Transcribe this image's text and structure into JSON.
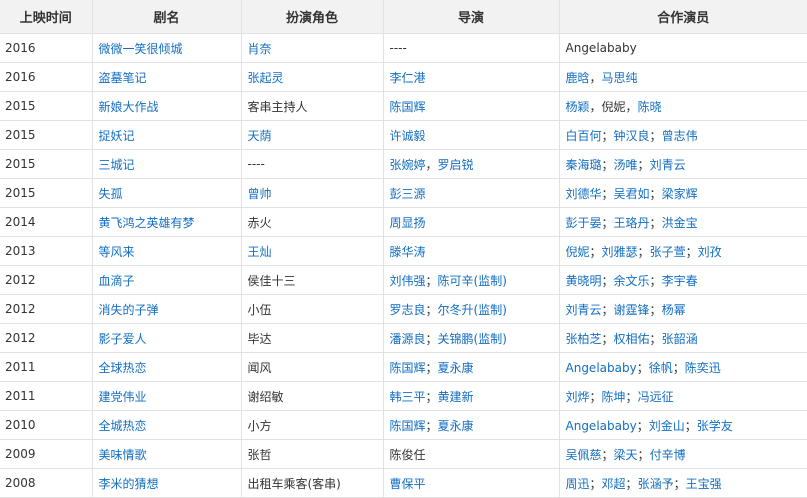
{
  "headers": [
    "上映时间",
    "剧名",
    "扮演角色",
    "导演",
    "合作演员"
  ],
  "rows": [
    {
      "year": "2016",
      "title": {
        "text": "微微一笑很倾城",
        "link": true
      },
      "role": {
        "text": "肖奈",
        "link": true
      },
      "director": [
        {
          "text": "----",
          "link": false
        }
      ],
      "director_sep": "",
      "costars": [
        {
          "text": "Angelababy",
          "link": false
        }
      ],
      "costar_sep": ""
    },
    {
      "year": "2016",
      "title": {
        "text": "盗墓笔记",
        "link": true
      },
      "role": {
        "text": "张起灵",
        "link": true
      },
      "director": [
        {
          "text": "李仁港",
          "link": true
        }
      ],
      "director_sep": "",
      "costars": [
        {
          "text": "鹿晗",
          "link": true
        },
        {
          "text": "马思纯",
          "link": true
        }
      ],
      "costar_sep": "，"
    },
    {
      "year": "2015",
      "title": {
        "text": "新娘大作战",
        "link": true
      },
      "role": {
        "text": "客串主持人",
        "link": false
      },
      "director": [
        {
          "text": "陈国辉",
          "link": true
        }
      ],
      "director_sep": "",
      "costars": [
        {
          "text": "杨颖",
          "link": true
        },
        {
          "text": "倪妮",
          "link": false
        },
        {
          "text": "陈晓",
          "link": true
        }
      ],
      "costar_sep": "，"
    },
    {
      "year": "2015",
      "title": {
        "text": "捉妖记",
        "link": true
      },
      "role": {
        "text": "天荫",
        "link": true
      },
      "director": [
        {
          "text": "许诚毅",
          "link": true
        }
      ],
      "director_sep": "",
      "costars": [
        {
          "text": "白百何",
          "link": true
        },
        {
          "text": "钟汉良",
          "link": true
        },
        {
          "text": "曾志伟",
          "link": true
        }
      ],
      "costar_sep": "；"
    },
    {
      "year": "2015",
      "title": {
        "text": "三城记",
        "link": true
      },
      "role": {
        "text": "----",
        "link": false
      },
      "director": [
        {
          "text": "张婉婷",
          "link": true
        },
        {
          "text": "罗启锐",
          "link": true
        }
      ],
      "director_sep": "，",
      "costars": [
        {
          "text": "秦海璐",
          "link": true
        },
        {
          "text": "汤唯",
          "link": true
        },
        {
          "text": "刘青云",
          "link": true
        }
      ],
      "costar_sep": "；"
    },
    {
      "year": "2015",
      "title": {
        "text": "失孤",
        "link": true
      },
      "role": {
        "text": "曾帅",
        "link": true
      },
      "director": [
        {
          "text": "彭三源",
          "link": true
        }
      ],
      "director_sep": "",
      "costars": [
        {
          "text": "刘德华",
          "link": true
        },
        {
          "text": "吴君如",
          "link": true
        },
        {
          "text": "梁家辉",
          "link": true
        }
      ],
      "costar_sep": "；"
    },
    {
      "year": "2014",
      "title": {
        "text": "黄飞鸿之英雄有梦",
        "link": true
      },
      "role": {
        "text": "赤火",
        "link": false
      },
      "director": [
        {
          "text": "周显扬",
          "link": true
        }
      ],
      "director_sep": "",
      "costars": [
        {
          "text": "彭于晏",
          "link": true
        },
        {
          "text": "王珞丹",
          "link": true
        },
        {
          "text": "洪金宝",
          "link": true
        }
      ],
      "costar_sep": "；"
    },
    {
      "year": "2013",
      "title": {
        "text": "等风来",
        "link": true
      },
      "role": {
        "text": "王灿",
        "link": true
      },
      "director": [
        {
          "text": "滕华涛",
          "link": true
        }
      ],
      "director_sep": "",
      "costars": [
        {
          "text": "倪妮",
          "link": true
        },
        {
          "text": "刘雅瑟",
          "link": true
        },
        {
          "text": "张子萱",
          "link": true
        },
        {
          "text": "刘孜",
          "link": true
        }
      ],
      "costar_sep": "；"
    },
    {
      "year": "2012",
      "title": {
        "text": "血滴子",
        "link": true
      },
      "role": {
        "text": "侯佳十三",
        "link": false
      },
      "director": [
        {
          "text": "刘伟强",
          "link": true
        },
        {
          "text": "陈可辛(监制)",
          "link": true
        }
      ],
      "director_sep": "；",
      "costars": [
        {
          "text": "黄晓明",
          "link": true
        },
        {
          "text": "余文乐",
          "link": true
        },
        {
          "text": "李宇春",
          "link": true
        }
      ],
      "costar_sep": "；"
    },
    {
      "year": "2012",
      "title": {
        "text": "消失的子弹",
        "link": true
      },
      "role": {
        "text": "小伍",
        "link": false
      },
      "director": [
        {
          "text": "罗志良",
          "link": true
        },
        {
          "text": "尔冬升(监制)",
          "link": true
        }
      ],
      "director_sep": "；",
      "costars": [
        {
          "text": "刘青云",
          "link": true
        },
        {
          "text": "谢霆锋",
          "link": true
        },
        {
          "text": "杨幂",
          "link": true
        }
      ],
      "costar_sep": "；"
    },
    {
      "year": "2012",
      "title": {
        "text": "影子爱人",
        "link": true
      },
      "role": {
        "text": "毕达",
        "link": false
      },
      "director": [
        {
          "text": "潘源良",
          "link": true
        },
        {
          "text": "关锦鹏(监制)",
          "link": true
        }
      ],
      "director_sep": "；",
      "costars": [
        {
          "text": "张柏芝",
          "link": true
        },
        {
          "text": "权相佑",
          "link": true
        },
        {
          "text": "张韶涵",
          "link": true
        }
      ],
      "costar_sep": "；"
    },
    {
      "year": "2011",
      "title": {
        "text": "全球热恋",
        "link": true
      },
      "role": {
        "text": "闻风",
        "link": false
      },
      "director": [
        {
          "text": "陈国辉",
          "link": true
        },
        {
          "text": "夏永康",
          "link": true
        }
      ],
      "director_sep": "；",
      "costars": [
        {
          "text": "Angelababy",
          "link": true
        },
        {
          "text": "徐帆",
          "link": true
        },
        {
          "text": "陈奕迅",
          "link": true
        }
      ],
      "costar_sep": "；"
    },
    {
      "year": "2011",
      "title": {
        "text": "建党伟业",
        "link": true
      },
      "role": {
        "text": "谢绍敏",
        "link": false
      },
      "director": [
        {
          "text": "韩三平",
          "link": true
        },
        {
          "text": "黄建新",
          "link": true
        }
      ],
      "director_sep": "；",
      "costars": [
        {
          "text": "刘烨",
          "link": true
        },
        {
          "text": "陈坤",
          "link": true
        },
        {
          "text": "冯远征",
          "link": true
        }
      ],
      "costar_sep": "；"
    },
    {
      "year": "2010",
      "title": {
        "text": "全城热恋",
        "link": true
      },
      "role": {
        "text": "小方",
        "link": false
      },
      "director": [
        {
          "text": "陈国辉",
          "link": true
        },
        {
          "text": "夏永康",
          "link": true
        }
      ],
      "director_sep": "；",
      "costars": [
        {
          "text": "Angelababy",
          "link": true
        },
        {
          "text": "刘金山",
          "link": true
        },
        {
          "text": "张学友",
          "link": true
        }
      ],
      "costar_sep": "；"
    },
    {
      "year": "2009",
      "title": {
        "text": "美味情歌",
        "link": true
      },
      "role": {
        "text": "张哲",
        "link": false
      },
      "director": [
        {
          "text": "陈俊任",
          "link": false
        }
      ],
      "director_sep": "",
      "costars": [
        {
          "text": "吴佩慈",
          "link": true
        },
        {
          "text": "梁天",
          "link": true
        },
        {
          "text": "付辛博",
          "link": true
        }
      ],
      "costar_sep": "；"
    },
    {
      "year": "2008",
      "title": {
        "text": "李米的猜想",
        "link": true
      },
      "role": {
        "text": "出租车乘客(客串)",
        "link": false
      },
      "director": [
        {
          "text": "曹保平",
          "link": true
        }
      ],
      "director_sep": "",
      "costars": [
        {
          "text": "周迅",
          "link": true
        },
        {
          "text": "邓超",
          "link": true
        },
        {
          "text": "张涵予",
          "link": true
        },
        {
          "text": "王宝强",
          "link": true
        }
      ],
      "costar_sep": "；"
    }
  ]
}
